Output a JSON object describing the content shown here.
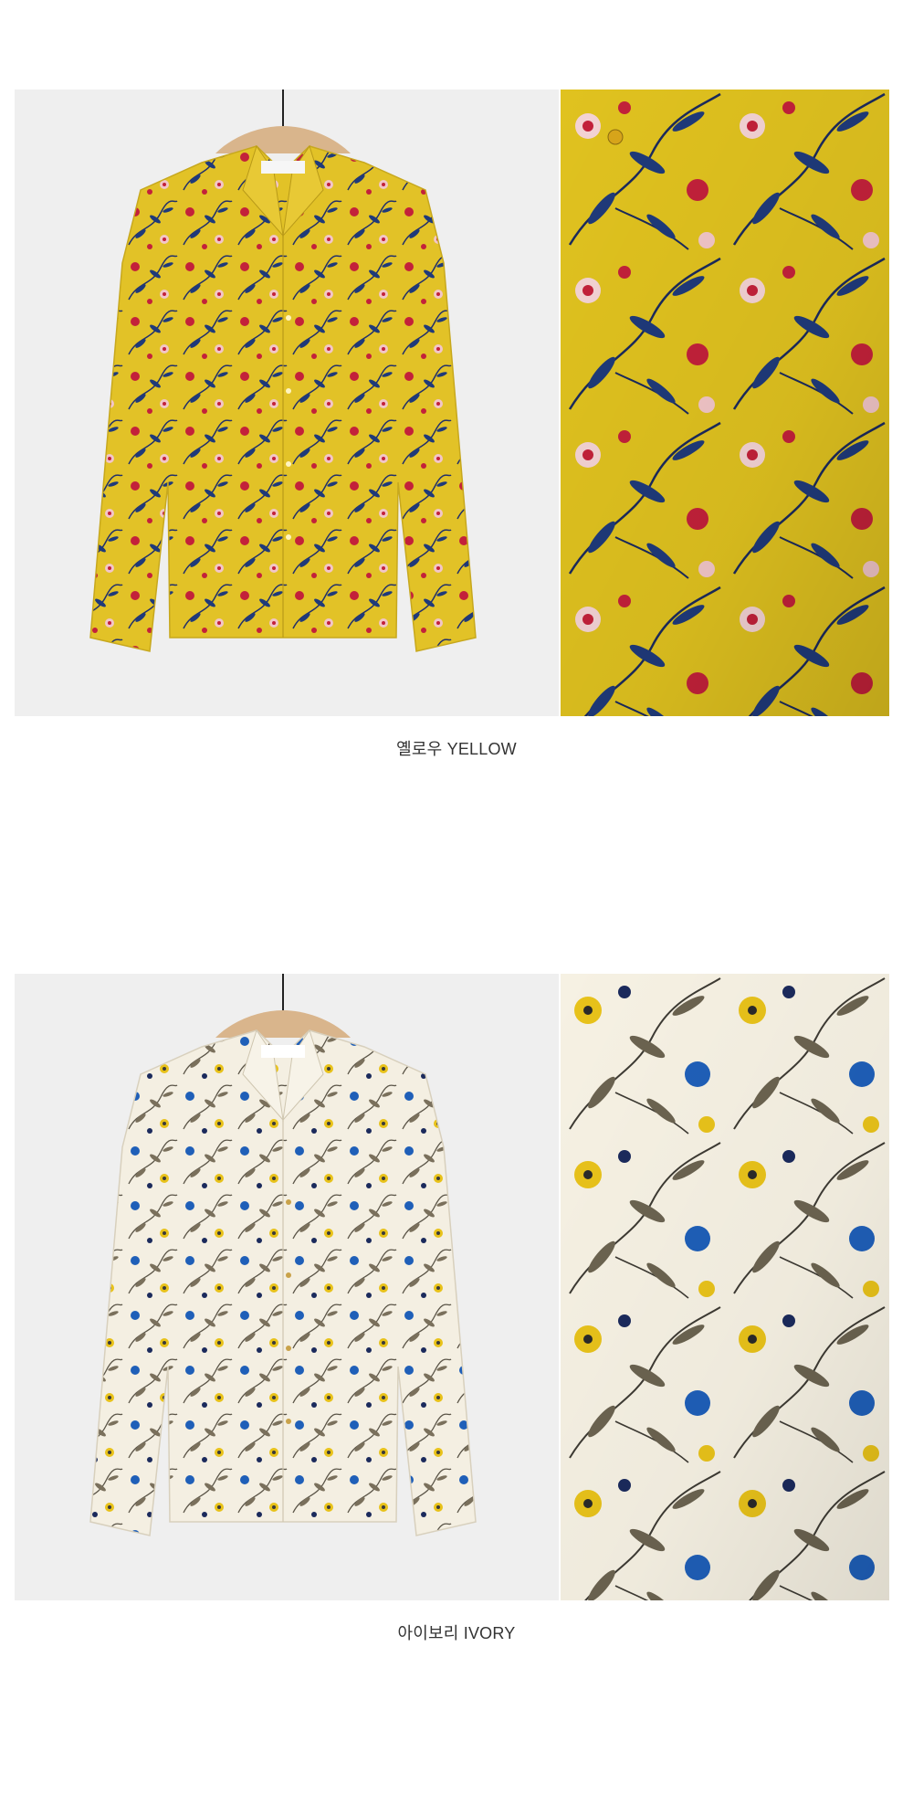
{
  "colors": {
    "background": "#ffffff",
    "studio_backdrop": "#efefef",
    "yellow_fabric": "#e2c227",
    "ivory_fabric": "#f4efe2",
    "leaf_navy": "#1f3a7a",
    "flower_red": "#c3213a",
    "flower_blue": "#1f5fb8",
    "flower_yellow": "#e8c21a",
    "leaf_olive": "#6b6350",
    "caption_text": "#333333"
  },
  "products": [
    {
      "variant": "yellow",
      "caption": "옐로우 YELLOW",
      "front_image": "yellow-floral-blouse-on-hanger",
      "detail_image": "yellow-floral-fabric-closeup"
    },
    {
      "variant": "ivory",
      "caption": "아이보리 IVORY",
      "front_image": "ivory-floral-blouse-on-hanger",
      "detail_image": "ivory-floral-fabric-closeup"
    }
  ]
}
